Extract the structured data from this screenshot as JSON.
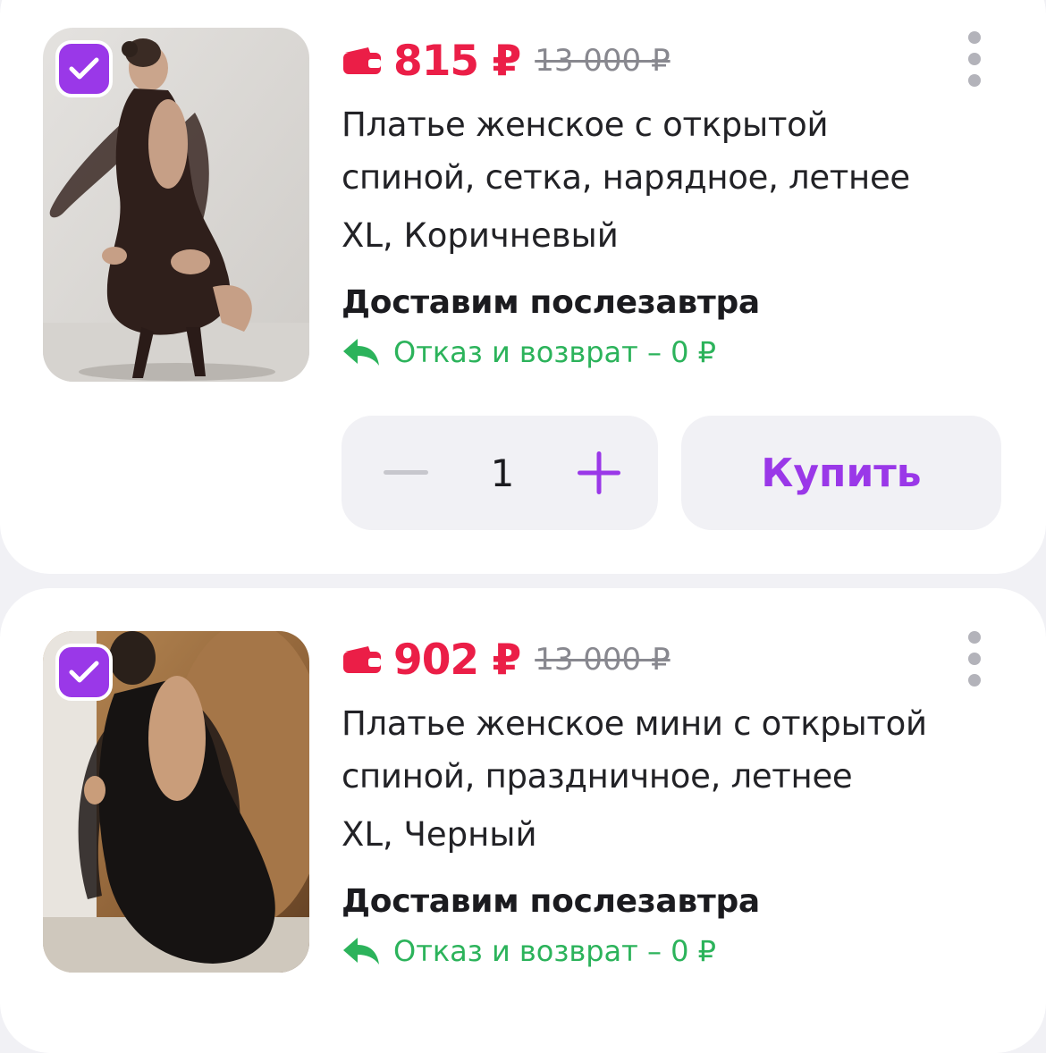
{
  "colors": {
    "price": "#eb1e47",
    "accent": "#9a38e8",
    "return": "#2cb35b",
    "muted": "#88888f"
  },
  "products": [
    {
      "price": "815 ₽",
      "old_price": "13 000 ₽",
      "title": "Платье женское с открытой спиной, сетка, нарядное, летнее",
      "variant": "XL, Коричневый",
      "delivery": "Доставим послезавтра",
      "return_text": "Отказ и возврат – 0 ₽",
      "quantity": "1",
      "buy_label": "Купить",
      "selected": true
    },
    {
      "price": "902 ₽",
      "old_price": "13 000 ₽",
      "title": "Платье женское мини с открытой спиной, праздничное, летнее",
      "variant": "XL, Черный",
      "delivery": "Доставим послезавтра",
      "return_text": "Отказ и возврат – 0 ₽",
      "selected": true
    }
  ]
}
